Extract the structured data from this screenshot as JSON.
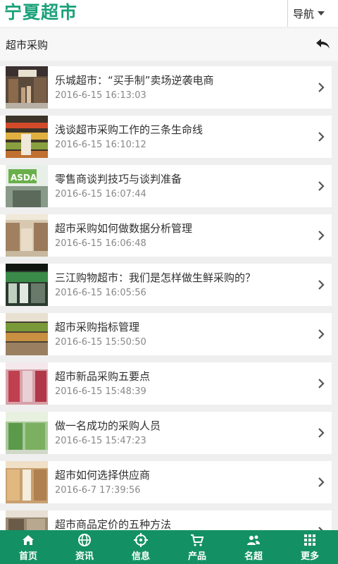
{
  "header": {
    "logo": "宁夏超市",
    "nav_label": "导航"
  },
  "breadcrumb": {
    "title": "超市采购"
  },
  "articles": [
    {
      "title": "乐城超市：“买手制”卖场逆袭电商",
      "date": "2016-6-15 16:13:03"
    },
    {
      "title": "浅谈超市采购工作的三条生命线",
      "date": "2016-6-15 16:10:12"
    },
    {
      "title": "零售商谈判技巧与谈判准备",
      "date": "2016-6-15 16:07:44"
    },
    {
      "title": "超市采购如何做数据分析管理",
      "date": "2016-6-15 16:06:48"
    },
    {
      "title": "三江购物超市：我们是怎样做生鲜采购的？",
      "date": "2016-6-15 16:05:56"
    },
    {
      "title": "超市采购指标管理",
      "date": "2016-6-15 15:50:50"
    },
    {
      "title": "超市新品采购五要点",
      "date": "2016-6-15 15:48:39"
    },
    {
      "title": "做一名成功的采购人员",
      "date": "2016-6-15 15:47:23"
    },
    {
      "title": "超市如何选择供应商",
      "date": "2016-6-7 17:39:56"
    },
    {
      "title": "超市商品定价的五种方法",
      "date": ""
    }
  ],
  "bottom_nav": [
    {
      "label": "首页",
      "icon": "home-icon"
    },
    {
      "label": "资讯",
      "icon": "globe-icon"
    },
    {
      "label": "信息",
      "icon": "target-icon"
    },
    {
      "label": "产品",
      "icon": "cart-icon"
    },
    {
      "label": "名超",
      "icon": "users-icon"
    },
    {
      "label": "更多",
      "icon": "grid-icon"
    }
  ],
  "colors": {
    "brand": "#1aa179",
    "bottom_bar": "#139165",
    "page_bg": "#efefef"
  }
}
